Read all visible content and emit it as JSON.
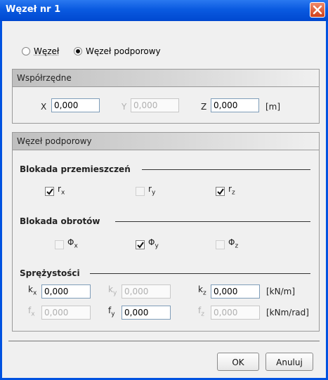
{
  "window": {
    "title": "Węzeł nr 1"
  },
  "node_type": {
    "options": [
      "Węzeł",
      "Węzeł podporowy"
    ],
    "selected": "Węzeł podporowy"
  },
  "coords": {
    "header": "Współrzędne",
    "x_label": "X",
    "x_value": "0,000",
    "y_label": "Y",
    "y_value": "0,000",
    "z_label": "Z",
    "z_value": "0,000",
    "unit": "[m]"
  },
  "support": {
    "header": "Węzeł podporowy",
    "translation": {
      "title": "Blokada przemieszczeń",
      "rx": {
        "label": "r",
        "sub": "x",
        "checked": true,
        "enabled": true
      },
      "ry": {
        "label": "r",
        "sub": "y",
        "checked": false,
        "enabled": false
      },
      "rz": {
        "label": "r",
        "sub": "z",
        "checked": true,
        "enabled": true
      }
    },
    "rotation": {
      "title": "Blokada obrotów",
      "px": {
        "label": "Φ",
        "sub": "x",
        "checked": false,
        "enabled": false
      },
      "py": {
        "label": "Φ",
        "sub": "y",
        "checked": true,
        "enabled": true
      },
      "pz": {
        "label": "Φ",
        "sub": "z",
        "checked": false,
        "enabled": false
      }
    },
    "elasticity": {
      "title": "Sprężystości",
      "kx": {
        "label": "k",
        "sub": "x",
        "value": "0,000",
        "enabled": true
      },
      "ky": {
        "label": "k",
        "sub": "y",
        "value": "0,000",
        "enabled": false
      },
      "kz": {
        "label": "k",
        "sub": "z",
        "value": "0,000",
        "enabled": true
      },
      "k_unit": "[kN/m]",
      "fx": {
        "label": "f",
        "sub": "x",
        "value": "0,000",
        "enabled": false
      },
      "fy": {
        "label": "f",
        "sub": "y",
        "value": "0,000",
        "enabled": true
      },
      "fz": {
        "label": "f",
        "sub": "z",
        "value": "0,000",
        "enabled": false
      },
      "f_unit": "[kNm/rad]"
    }
  },
  "buttons": {
    "ok": "OK",
    "cancel": "Anuluj"
  },
  "colors": {
    "titlebar": "#0a5ae0",
    "close": "#d0401a",
    "panel_bg": "#f0f0f0"
  }
}
